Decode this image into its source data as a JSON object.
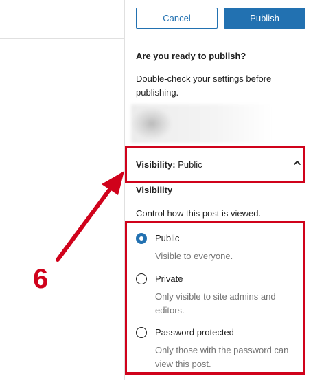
{
  "header": {
    "cancel_label": "Cancel",
    "publish_label": "Publish"
  },
  "prepublish": {
    "title": "Are you ready to publish?",
    "description": "Double-check your settings before publishing."
  },
  "visibility_toggle": {
    "label": "Visibility:",
    "value": "Public"
  },
  "visibility_section": {
    "heading": "Visibility",
    "description": "Control how this post is viewed.",
    "options": [
      {
        "label": "Public",
        "help": "Visible to everyone.",
        "checked": true
      },
      {
        "label": "Private",
        "help": "Only visible to site admins and editors.",
        "checked": false
      },
      {
        "label": "Password protected",
        "help": "Only those with the password can view this post.",
        "checked": false
      }
    ]
  },
  "annotation": {
    "step_number": "6",
    "color": "#d0021b"
  },
  "colors": {
    "accent": "#2271b1",
    "help_text": "#757575"
  }
}
